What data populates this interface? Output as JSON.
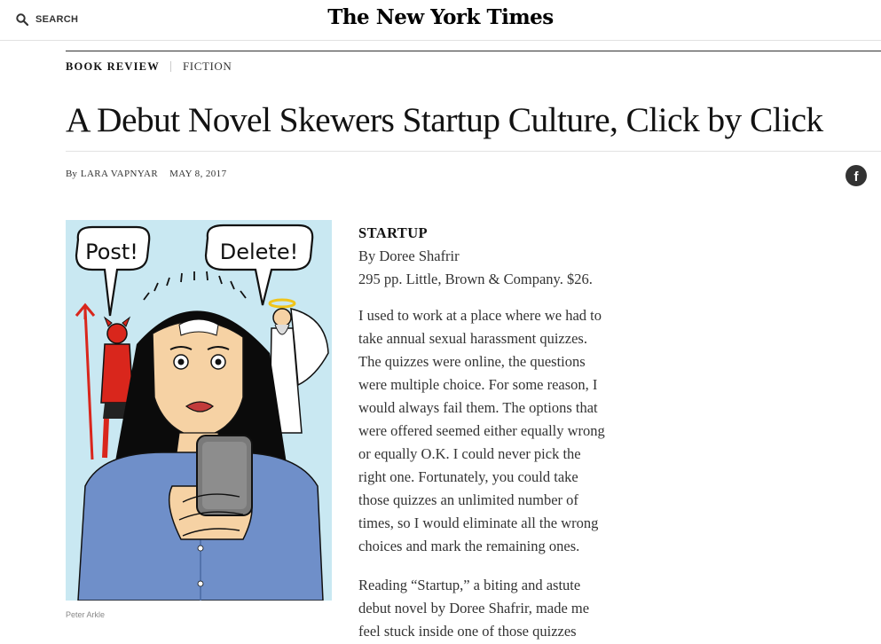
{
  "header": {
    "search_label": "SEARCH",
    "masthead": "The New York Times"
  },
  "kicker": {
    "section": "Book Review",
    "subsection": "Fiction"
  },
  "headline": "A Debut Novel Skewers Startup Culture, Click by Click",
  "byline": {
    "prefix": "By",
    "author": "Lara Vapnyar",
    "date": "May 8, 2017"
  },
  "share": {
    "facebook_icon": "facebook-icon"
  },
  "illustration": {
    "bubble_left": "Post!",
    "bubble_right": "Delete!",
    "credit": "Peter Arkle"
  },
  "book": {
    "title": "Startup",
    "author_line": "By Doree Shafrir",
    "details": "295 pp. Little, Brown & Company. $26."
  },
  "body": {
    "para1_lines": [
      "I used to work at a place where we had to",
      "take annual sexual harassment quizzes.",
      "The quizzes were online, the questions",
      "were multiple choice. For some reason, I",
      "would always fail them. The options that",
      "were offered seemed either equally wrong",
      "or equally O.K. I could never pick the",
      "right one. Fortunately, you could take",
      "those quizzes an unlimited number of",
      "times, so I would eliminate all the wrong",
      "choices and mark the remaining ones."
    ],
    "para2_lines": [
      "Reading “Startup,” a biting and astute",
      "debut novel by Doree Shafrir, made me",
      "feel stuck inside one of those quizzes"
    ]
  },
  "colors": {
    "text": "#121212",
    "rule": "#e2e2e2",
    "illustration_sky": "#c9e8f2",
    "shirt": "#6f8fc9",
    "devil": "#d9261c",
    "skin": "#f6d2a4"
  }
}
